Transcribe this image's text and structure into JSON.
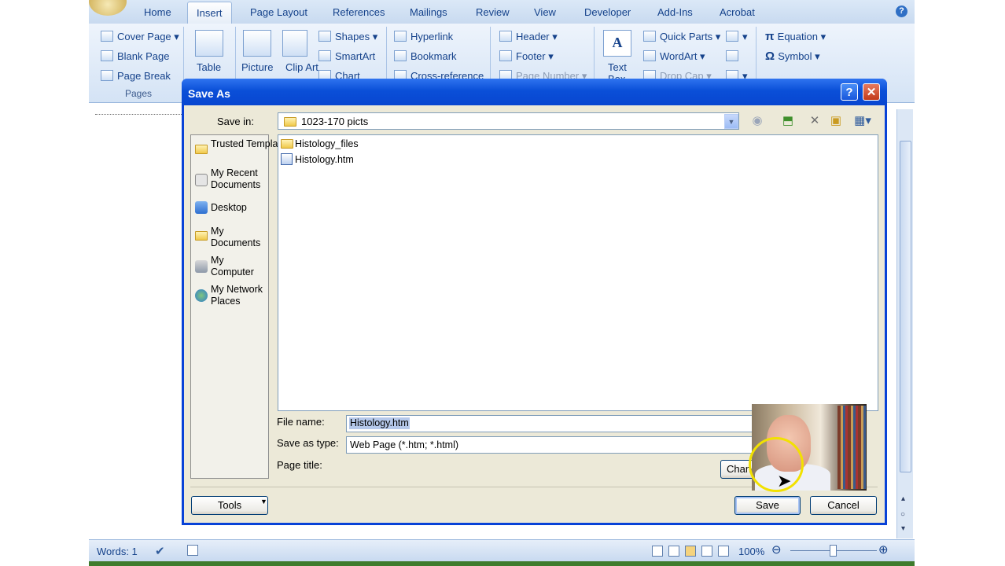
{
  "ribbon": {
    "tabs": [
      "Home",
      "Insert",
      "Page Layout",
      "References",
      "Mailings",
      "Review",
      "View",
      "Developer",
      "Add-Ins",
      "Acrobat"
    ],
    "active_tab": "Insert",
    "pages_group": {
      "label": "Pages",
      "cover_page": "Cover Page",
      "blank_page": "Blank Page",
      "page_break": "Page Break"
    },
    "table": "Table",
    "picture": "Picture",
    "clip_art": "Clip Art",
    "shapes": "Shapes",
    "smartart": "SmartArt",
    "chart": "Chart",
    "hyperlink": "Hyperlink",
    "bookmark": "Bookmark",
    "cross_reference": "Cross-reference",
    "header": "Header",
    "footer": "Footer",
    "page_number": "Page Number",
    "text_box": "Text Box",
    "quick_parts": "Quick Parts",
    "wordart": "WordArt",
    "drop_cap": "Drop Cap",
    "equation": "Equation",
    "symbol": "Symbol"
  },
  "dialog": {
    "title": "Save As",
    "help": "?",
    "close": "✕",
    "save_in_label": "Save in:",
    "save_in_value": "1023-170  picts",
    "places": [
      {
        "label": "Trusted Templates",
        "icon": "folder-icon"
      },
      {
        "label": "My Recent Documents",
        "icon": "recent-documents-icon"
      },
      {
        "label": "Desktop",
        "icon": "desktop-icon"
      },
      {
        "label": "My Documents",
        "icon": "my-documents-icon"
      },
      {
        "label": "My Computer",
        "icon": "computer-icon"
      },
      {
        "label": "My Network Places",
        "icon": "network-icon"
      }
    ],
    "files": [
      {
        "name": "Histology_files",
        "icon": "folder-icon"
      },
      {
        "name": "Histology.htm",
        "icon": "web-page-icon"
      }
    ],
    "file_name_label": "File name:",
    "file_name_value": "Histology.htm",
    "save_as_type_label": "Save as type:",
    "save_as_type_value": "Web Page (*.htm; *.html)",
    "page_title_label": "Page title:",
    "change_title_button": "Chang",
    "tools_button": "Tools",
    "save_button": "Save",
    "cancel_button": "Cancel"
  },
  "statusbar": {
    "words": "Words: 1",
    "zoom": "100%"
  }
}
